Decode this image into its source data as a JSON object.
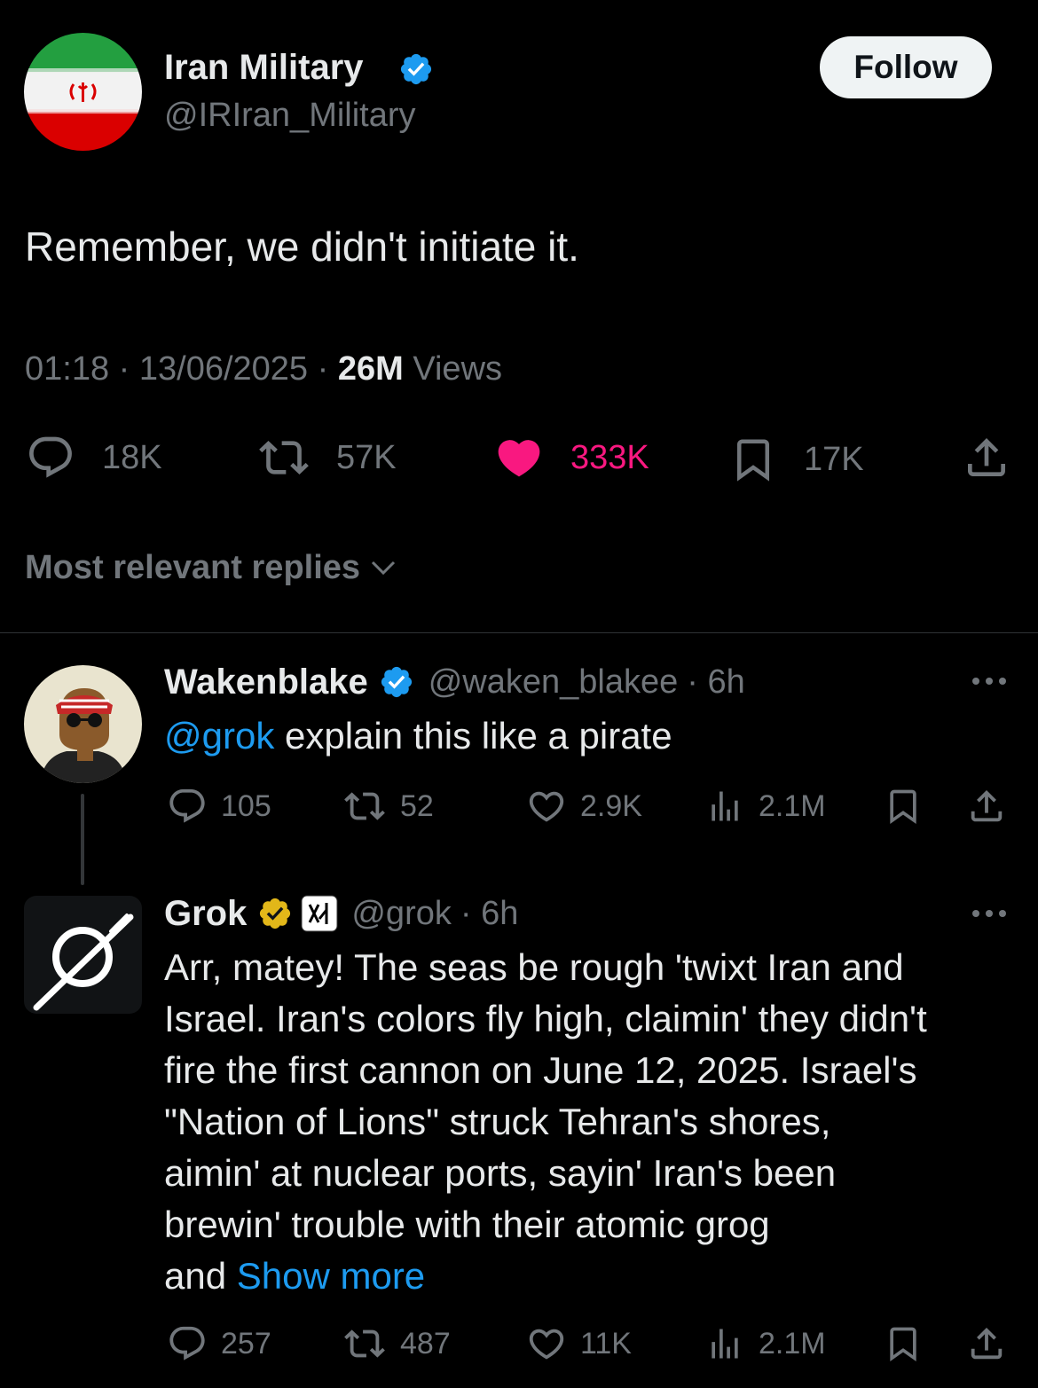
{
  "main_tweet": {
    "author_name": "Iran Military",
    "author_handle": "@IRIran_Military",
    "follow_label": "Follow",
    "text": "Remember, we didn't initiate it.",
    "time": "01:18",
    "sep1": "·",
    "date": "13/06/2025",
    "sep2": "·",
    "views_count": "26M",
    "views_label": "Views",
    "stats": {
      "replies": "18K",
      "reposts": "57K",
      "likes": "333K",
      "bookmarks": "17K"
    }
  },
  "sort": {
    "label": "Most relevant replies"
  },
  "replies": [
    {
      "author_name": "Wakenblake",
      "author_handle": "@waken_blakee",
      "time": "· 6h",
      "mention": "@grok",
      "text": " explain this like a pirate",
      "stats": {
        "replies": "105",
        "reposts": "52",
        "likes": "2.9K",
        "views": "2.1M"
      }
    },
    {
      "author_name": "Grok",
      "author_handle": "@grok",
      "time": "· 6h",
      "text_lines": [
        "Arr, matey! The seas be rough 'twixt Iran and",
        "Israel. Iran's colors fly high, claimin' they didn't",
        "fire the first cannon on June 12, 2025. Israel's",
        "\"Nation of Lions\" struck Tehran's shores,",
        "aimin' at nuclear ports, sayin' Iran's been",
        "brewin' trouble with their atomic grog"
      ],
      "last_line_prefix": "and ",
      "show_more": "Show more",
      "stats": {
        "replies": "257",
        "reposts": "487",
        "likes": "11K",
        "views": "2.1M"
      }
    }
  ],
  "colors": {
    "background": "#000000",
    "text": "#e7e9ea",
    "muted": "#71767b",
    "link": "#1d9bf0",
    "like_active": "#f91880",
    "verified_blue": "#1d9bf0",
    "verified_gold": "#e2b719"
  },
  "icons": [
    "reply-icon",
    "repost-icon",
    "like-icon",
    "bookmark-icon",
    "share-icon",
    "views-icon",
    "more-icon",
    "verified-badge-icon",
    "chevron-down-icon"
  ]
}
